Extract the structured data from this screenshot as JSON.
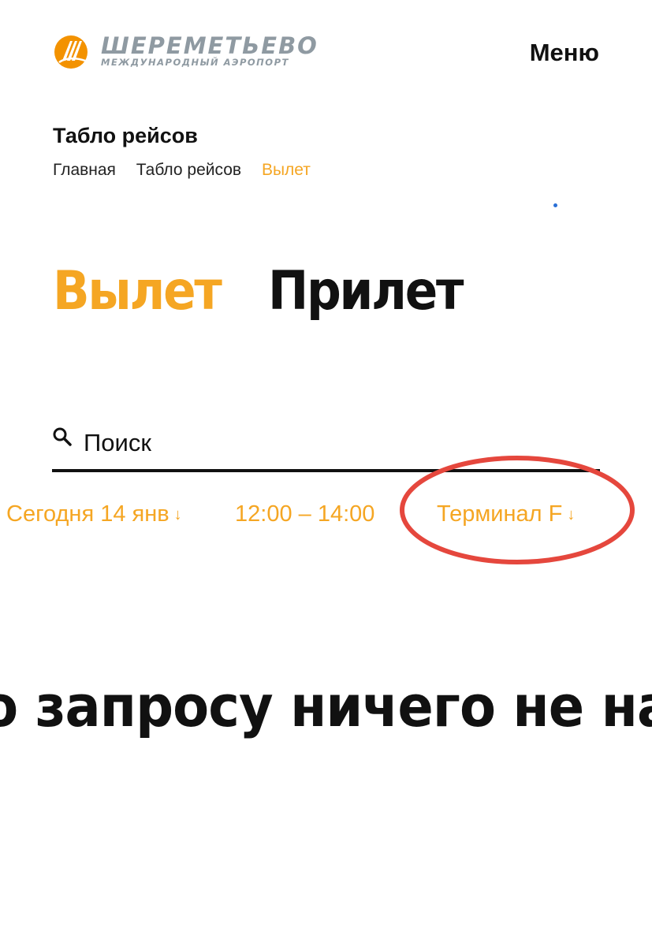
{
  "header": {
    "logo": {
      "title": "ШЕРЕМЕТЬЕВО",
      "subtitle": "МЕЖДУНАРОДНЫЙ АЭРОПОРТ",
      "icon": "airport-logo-icon",
      "colors": {
        "mark": "#f39200",
        "text": "#8f9aa2"
      }
    },
    "menu_label": "Меню"
  },
  "page": {
    "title": "Табло рейсов",
    "breadcrumb": [
      "Главная",
      "Табло рейсов",
      "Вылет"
    ]
  },
  "tabs": [
    {
      "label": "Вылет",
      "active": true
    },
    {
      "label": "Прилет",
      "active": false
    }
  ],
  "search": {
    "placeholder": "Поиск",
    "value": "",
    "icon": "search-icon"
  },
  "filters": {
    "date": {
      "label": "Сегодня 14 янв",
      "icon": "arrow-down-icon"
    },
    "time": {
      "label": "12:00 – 14:00"
    },
    "terminal": {
      "label": "Терминал F",
      "icon": "arrow-down-icon"
    }
  },
  "annotation": {
    "shape": "ellipse",
    "color": "#e5473d",
    "target": "terminal-filter"
  },
  "results": {
    "empty_message": "По запросу ничего не найдено"
  },
  "colors": {
    "accent": "#f5a623",
    "text": "#111111",
    "background": "#ffffff"
  }
}
